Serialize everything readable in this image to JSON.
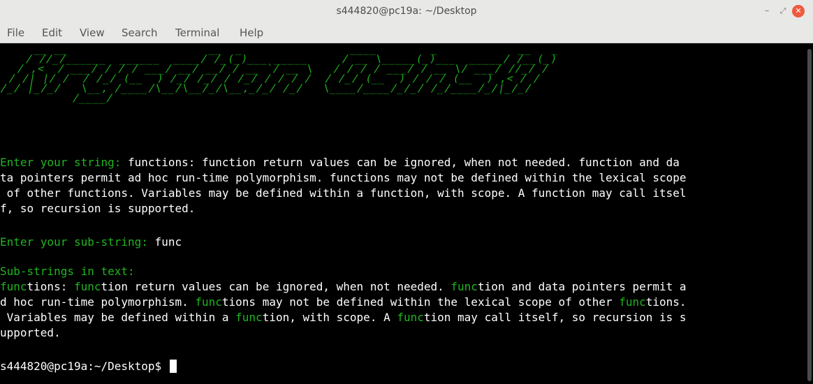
{
  "window": {
    "title": "s444820@pc19a: ~/Desktop",
    "min_glyph": "–",
    "max_glyph": "⤢",
    "close_glyph": "✕"
  },
  "menu": {
    "items": [
      "File",
      "Edit",
      "View",
      "Search",
      "Terminal",
      "Help"
    ]
  },
  "terminal": {
    "banner_text": "Krystian Osiński",
    "banner_lines": [
      "    __ __                     __  _                ____        _            __   _",
      "   / //_/______  ______  ____/ /_(_)___ _____     / __ \\_____(_)___  _____/ /__(_)",
      "  / ,<  / ___/ / / / ___/ __/ __/ / __ `/ __ \\   / / / / ___/ / __ \\/ ___/ //_/ /",
      " / /| |/ /  / /_/ (__  ) /_/ /_/ / /_/ / / / /  / /_/ (__  ) / / / (__  ) ,< / /",
      "/_/ |_/_/   \\__, /____/\\__/\\__/_/\\__,_/_/ /_/   \\____/____/_/_/ /_/____/_/|_/_/",
      "           /____/"
    ],
    "prompt_string": "Enter your string:",
    "input_string_lines": [
      " functions: function return values can be ignored, when not needed. function and da",
      "ta pointers permit ad hoc run-time polymorphism. functions may not be defined within the lexical scope",
      " of other functions. Variables may be defined within a function, with scope. A function may call itsel",
      "f, so recursion is supported."
    ],
    "prompt_substring": "Enter your sub-string:",
    "input_substring": " func",
    "result_heading": "Sub-strings in text:",
    "result_lines": [
      [
        {
          "t": "func",
          "h": true
        },
        {
          "t": "tions: ",
          "h": false
        },
        {
          "t": "func",
          "h": true
        },
        {
          "t": "tion return values can be ignored, when not needed. ",
          "h": false
        },
        {
          "t": "func",
          "h": true
        },
        {
          "t": "tion and data pointers permit a",
          "h": false
        }
      ],
      [
        {
          "t": "d hoc run-time polymorphism. ",
          "h": false
        },
        {
          "t": "func",
          "h": true
        },
        {
          "t": "tions may not be defined within the lexical scope of other ",
          "h": false
        },
        {
          "t": "func",
          "h": true
        },
        {
          "t": "tions.",
          "h": false
        }
      ],
      [
        {
          "t": " Variables may be defined within a ",
          "h": false
        },
        {
          "t": "func",
          "h": true
        },
        {
          "t": "tion, with scope. A ",
          "h": false
        },
        {
          "t": "func",
          "h": true
        },
        {
          "t": "tion may call itself, so recursion is s",
          "h": false
        }
      ],
      [
        {
          "t": "upported.",
          "h": false
        }
      ]
    ],
    "shell_prompt": "s444820@pc19a:~/Desktop$ "
  },
  "colors": {
    "terminal_bg": "#000000",
    "terminal_fg": "#ffffff",
    "accent_green": "#1fb51f",
    "chrome_bg": "#e8e8e7",
    "close_red": "#ef5a3f"
  }
}
